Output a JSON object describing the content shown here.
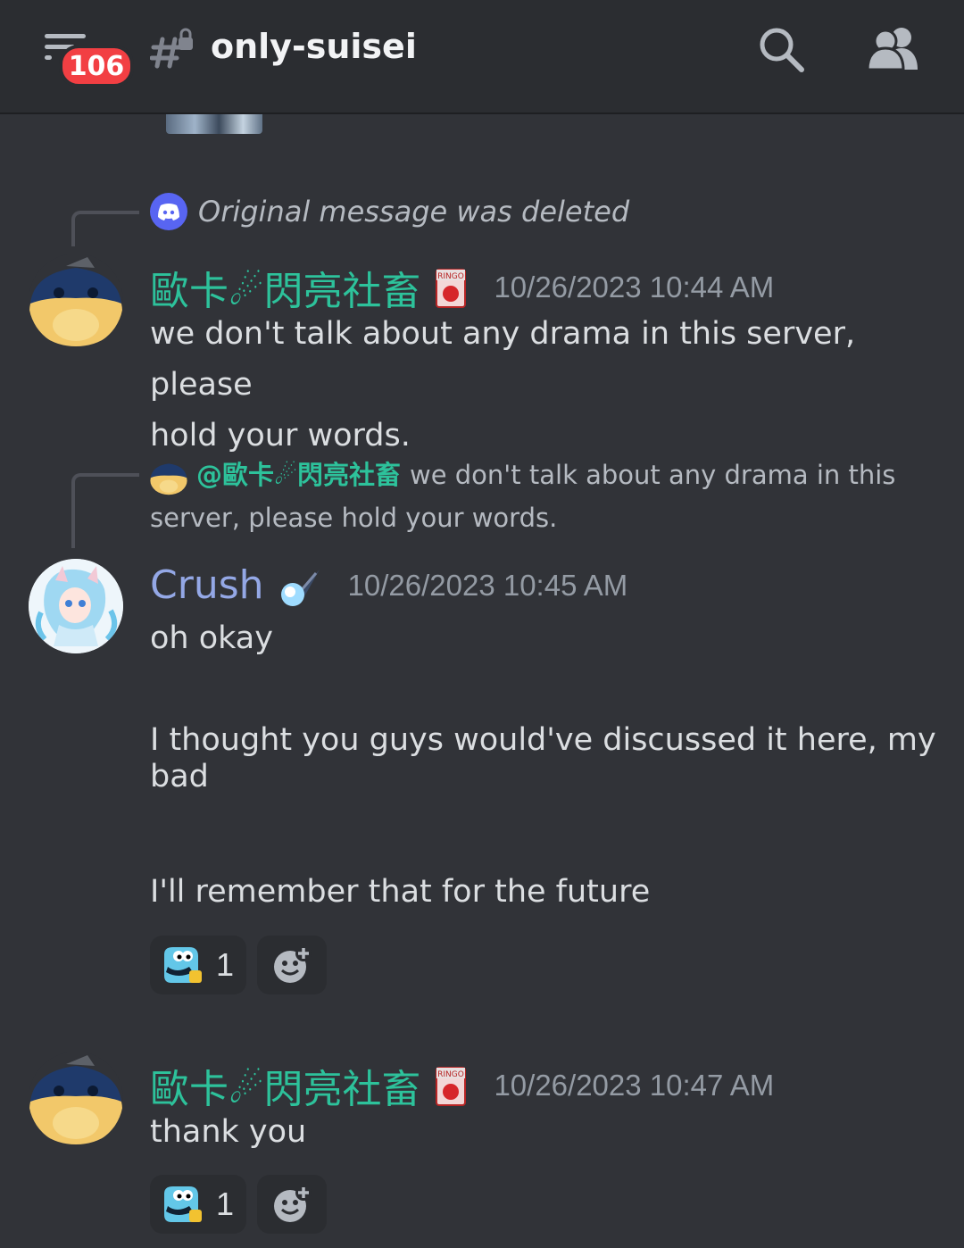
{
  "header": {
    "unread_badge": "106",
    "channel_name": "only-suisei"
  },
  "deleted_reply": {
    "text": "Original message was deleted"
  },
  "messages": [
    {
      "username": "歐卡☄閃亮社畜",
      "timestamp": "10/26/2023 10:44 AM",
      "lines": [
        "we don't talk about any drama in this server, please",
        "hold your words."
      ]
    },
    {
      "reply_to": {
        "mention": "@歐卡☄閃亮社畜",
        "text_line1": "we don't talk about any drama in this",
        "text_line2": "server, please hold your words."
      },
      "username": "Crush",
      "timestamp": "10/26/2023 10:45 AM",
      "lines": [
        "oh okay",
        "I thought you guys would've discussed it here, my",
        "bad",
        "I'll remember that for the future"
      ],
      "reaction": {
        "count": "1"
      }
    },
    {
      "username": "歐卡☄閃亮社畜",
      "timestamp": "10/26/2023 10:47 AM",
      "lines": [
        "thank you"
      ],
      "reaction": {
        "count": "1"
      }
    }
  ],
  "colors": {
    "background": "#313338",
    "header_bg": "#2b2d31",
    "username_green": "#2dc29b",
    "username_blue": "#94a8e6",
    "badge_red": "#f23f43"
  },
  "icons": {
    "menu": "hamburger-icon",
    "channel": "locked-hashtag-icon",
    "search": "search-icon",
    "members": "members-icon",
    "tag": "ringo-juice-icon",
    "crush_tag": "comet-icon",
    "reaction_emoji": "thumbs-up-blob-icon",
    "add_reaction": "add-reaction-icon"
  }
}
